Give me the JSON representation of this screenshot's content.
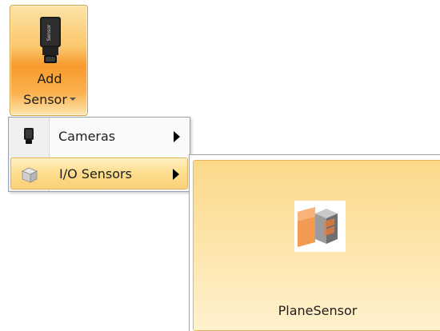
{
  "ribbon": {
    "add_sensor": {
      "line1": "Add",
      "line2": "Sensor",
      "icon": "camera-icon"
    }
  },
  "menu": {
    "items": [
      {
        "label": "Cameras",
        "icon": "camera-icon",
        "has_submenu": true
      },
      {
        "label": "I/O Sensors",
        "icon": "io-sensor-icon",
        "has_submenu": true,
        "highlighted": true
      }
    ]
  },
  "submenu": {
    "items": [
      {
        "label": "PlaneSensor",
        "icon": "plane-sensor-icon"
      }
    ]
  },
  "colors": {
    "ribbon_orange": "#f79a2e",
    "highlight_gold": "#fddc8c",
    "menu_border": "#9aa3ad"
  }
}
